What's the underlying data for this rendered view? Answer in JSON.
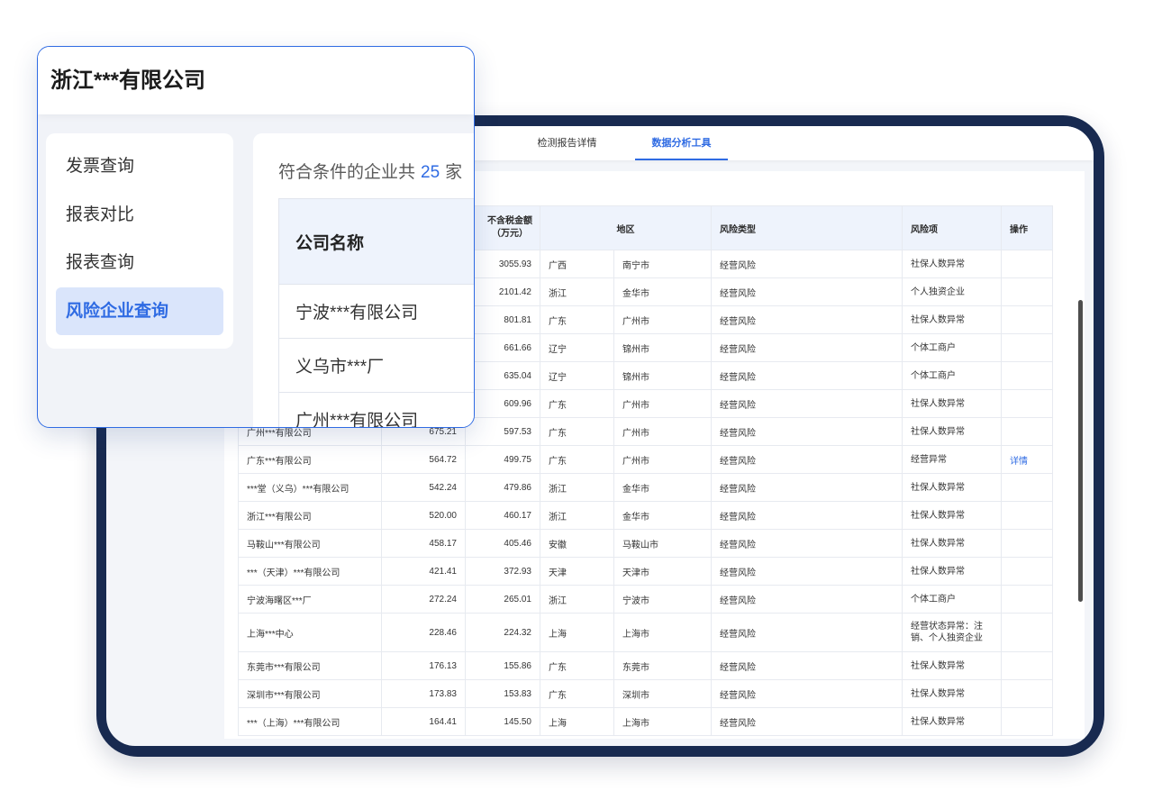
{
  "colors": {
    "accent": "#2f6be3",
    "frame": "#182a50",
    "active_menu_bg": "#dae5fb",
    "table_header_bg": "#eef3fc"
  },
  "overlay": {
    "title": "浙江***有限公司",
    "menu": [
      {
        "label": "发票查询",
        "active": false
      },
      {
        "label": "报表对比",
        "active": false
      },
      {
        "label": "报表查询",
        "active": false
      },
      {
        "label": "风险企业查询",
        "active": true
      }
    ],
    "summary": {
      "prefix": "符合条件的企业共",
      "count": "25",
      "suffix": "家"
    },
    "results_table": {
      "header": "公司名称",
      "rows": [
        "宁波***有限公司",
        "义乌市***厂",
        "广州***有限公司"
      ]
    }
  },
  "tablet": {
    "tabs": [
      {
        "label": "检测报告详情",
        "active": false
      },
      {
        "label": "数据分析工具",
        "active": true
      }
    ],
    "table": {
      "headers": {
        "tax_excluded": "不含税金额",
        "tax_excluded_unit": "（万元）",
        "region": "地区",
        "risk_type": "风险类型",
        "risk_item": "风险项",
        "action": "操作"
      },
      "rows": [
        {
          "amount_excl": "3055.93",
          "province": "广西",
          "city": "南宁市",
          "risk_type": "经营风险",
          "risk_item": "社保人数异常"
        },
        {
          "amount_excl": "2101.42",
          "province": "浙江",
          "city": "金华市",
          "risk_type": "经营风险",
          "risk_item": "个人独资企业"
        },
        {
          "amount_excl": "801.81",
          "province": "广东",
          "city": "广州市",
          "risk_type": "经营风险",
          "risk_item": "社保人数异常"
        },
        {
          "amount_excl": "661.66",
          "province": "辽宁",
          "city": "锦州市",
          "risk_type": "经营风险",
          "risk_item": "个体工商户"
        },
        {
          "amount_excl": "635.04",
          "province": "辽宁",
          "city": "锦州市",
          "risk_type": "经营风险",
          "risk_item": "个体工商户"
        },
        {
          "amount_excl": "609.96",
          "province": "广东",
          "city": "广州市",
          "risk_type": "经营风险",
          "risk_item": "社保人数异常"
        },
        {
          "company": "广州***有限公司",
          "amount_incl": "675.21",
          "amount_excl": "597.53",
          "province": "广东",
          "city": "广州市",
          "risk_type": "经营风险",
          "risk_item": "社保人数异常"
        },
        {
          "company": "广东***有限公司",
          "amount_incl": "564.72",
          "amount_excl": "499.75",
          "province": "广东",
          "city": "广州市",
          "risk_type": "经营风险",
          "risk_item": "经营异常",
          "action": "详情"
        },
        {
          "company": "***堂（义乌）***有限公司",
          "amount_incl": "542.24",
          "amount_excl": "479.86",
          "province": "浙江",
          "city": "金华市",
          "risk_type": "经营风险",
          "risk_item": "社保人数异常"
        },
        {
          "company": "浙江***有限公司",
          "amount_incl": "520.00",
          "amount_excl": "460.17",
          "province": "浙江",
          "city": "金华市",
          "risk_type": "经营风险",
          "risk_item": "社保人数异常"
        },
        {
          "company": "马鞍山***有限公司",
          "amount_incl": "458.17",
          "amount_excl": "405.46",
          "province": "安徽",
          "city": "马鞍山市",
          "risk_type": "经营风险",
          "risk_item": "社保人数异常"
        },
        {
          "company": "***（天津）***有限公司",
          "amount_incl": "421.41",
          "amount_excl": "372.93",
          "province": "天津",
          "city": "天津市",
          "risk_type": "经营风险",
          "risk_item": "社保人数异常"
        },
        {
          "company": "宁波海曙区***厂",
          "amount_incl": "272.24",
          "amount_excl": "265.01",
          "province": "浙江",
          "city": "宁波市",
          "risk_type": "经营风险",
          "risk_item": "个体工商户"
        },
        {
          "company": "上海***中心",
          "amount_incl": "228.46",
          "amount_excl": "224.32",
          "province": "上海",
          "city": "上海市",
          "risk_type": "经营风险",
          "risk_item": "经营状态异常：注销、个人独资企业"
        },
        {
          "company": "东莞市***有限公司",
          "amount_incl": "176.13",
          "amount_excl": "155.86",
          "province": "广东",
          "city": "东莞市",
          "risk_type": "经营风险",
          "risk_item": "社保人数异常"
        },
        {
          "company": "深圳市***有限公司",
          "amount_incl": "173.83",
          "amount_excl": "153.83",
          "province": "广东",
          "city": "深圳市",
          "risk_type": "经营风险",
          "risk_item": "社保人数异常"
        },
        {
          "company": "***（上海）***有限公司",
          "amount_incl": "164.41",
          "amount_excl": "145.50",
          "province": "上海",
          "city": "上海市",
          "risk_type": "经营风险",
          "risk_item": "社保人数异常"
        }
      ]
    }
  }
}
